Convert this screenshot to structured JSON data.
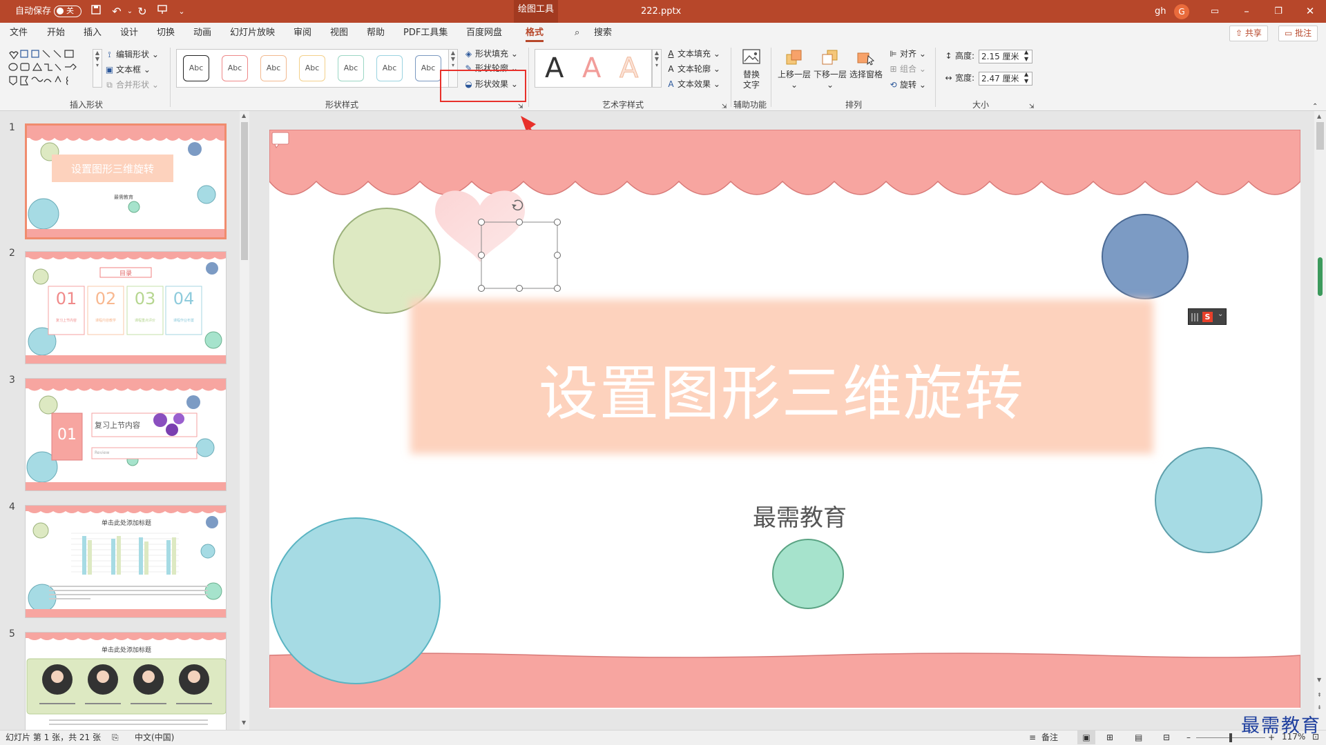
{
  "titlebar": {
    "autosave_label": "自动保存",
    "autosave_state": "关",
    "context_tab": "绘图工具",
    "filename": "222.pptx",
    "user_name": "gh",
    "avatar_initial": "G"
  },
  "menu": {
    "tabs": [
      "文件",
      "开始",
      "插入",
      "设计",
      "切换",
      "动画",
      "幻灯片放映",
      "审阅",
      "视图",
      "帮助",
      "PDF工具集",
      "百度网盘",
      "格式"
    ],
    "active_tab": "格式",
    "search_label": "搜索",
    "share_label": "共享",
    "comment_label": "批注"
  },
  "ribbon": {
    "insert_shapes": {
      "label": "插入形状",
      "edit_shape": "编辑形状",
      "text_box": "文本框",
      "merge_shapes": "合并形状"
    },
    "shape_styles": {
      "label": "形状样式",
      "gallery_items": [
        "Abc",
        "Abc",
        "Abc",
        "Abc",
        "Abc",
        "Abc",
        "Abc"
      ],
      "fill": "形状填充",
      "outline": "形状轮廓",
      "effects": "形状效果"
    },
    "wordart": {
      "label": "艺术字样式",
      "letter": "A",
      "text_fill": "文本填充",
      "text_outline": "文本轮廓",
      "text_effects": "文本效果"
    },
    "accessibility": {
      "label": "辅助功能",
      "alt_text": "替换文字"
    },
    "arrange": {
      "label": "排列",
      "bring_forward": "上移一层",
      "send_backward": "下移一层",
      "selection_pane": "选择窗格",
      "align": "对齐",
      "group": "组合",
      "rotate": "旋转"
    },
    "size": {
      "label": "大小",
      "height_label": "高度:",
      "height_value": "2.15 厘米",
      "width_label": "宽度:",
      "width_value": "2.47 厘米"
    }
  },
  "thumbnails": [
    {
      "num": "1",
      "title": "设置图形三维旋转",
      "sub": "最需教育"
    },
    {
      "num": "2",
      "title": "目录",
      "items": [
        "01",
        "02",
        "03",
        "04"
      ],
      "captions": [
        "复习上节内容",
        "课程内容教学",
        "课程重点评价",
        "课程作业布置"
      ]
    },
    {
      "num": "3",
      "title": "复习上节内容",
      "badge": "01",
      "sub": "Review"
    },
    {
      "num": "4",
      "title": "单击此处添加标题"
    },
    {
      "num": "5",
      "title": "单击此处添加标题"
    }
  ],
  "slide": {
    "title": "设置图形三维旋转",
    "subtitle": "最需教育"
  },
  "status": {
    "slide_info": "幻灯片 第 1 张，共 21 张",
    "language": "中文(中国)",
    "notes": "备注",
    "zoom": "117%"
  },
  "watermark": "最需教育",
  "colors": {
    "accent": "#b7472a",
    "highlight_box": "#e8302a",
    "scallop": "#f7a5a0",
    "title_box": "#fdd2bd"
  }
}
